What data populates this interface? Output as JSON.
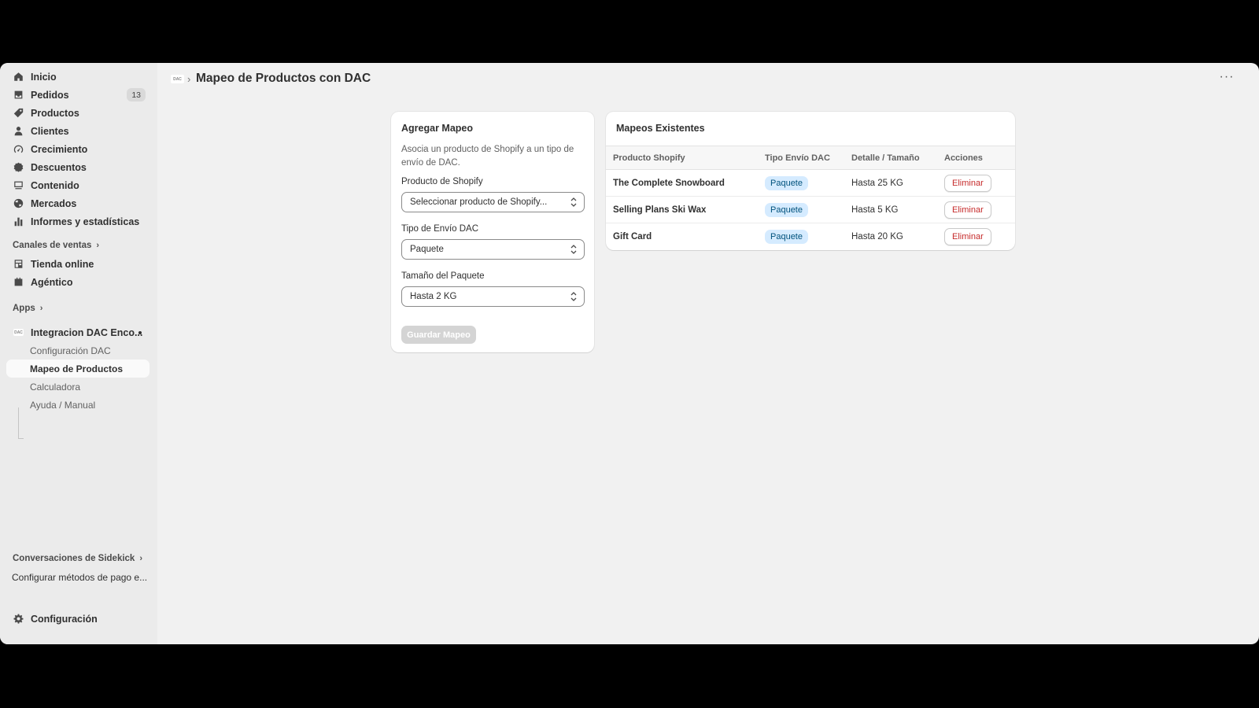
{
  "sidebar": {
    "items": [
      {
        "label": "Inicio",
        "icon": "home-icon"
      },
      {
        "label": "Pedidos",
        "icon": "inbox-icon",
        "badge": "13"
      },
      {
        "label": "Productos",
        "icon": "tag-icon"
      },
      {
        "label": "Clientes",
        "icon": "person-icon"
      },
      {
        "label": "Crecimiento",
        "icon": "gauge-icon"
      },
      {
        "label": "Descuentos",
        "icon": "discount-icon"
      },
      {
        "label": "Contenido",
        "icon": "content-icon"
      },
      {
        "label": "Mercados",
        "icon": "globe-icon"
      },
      {
        "label": "Informes y estadísticas",
        "icon": "chart-bar-icon"
      }
    ],
    "sales_channels_label": "Canales de ventas",
    "channels": [
      {
        "label": "Tienda online",
        "icon": "store-icon"
      },
      {
        "label": "Agéntico",
        "icon": "agentic-icon"
      }
    ],
    "apps_label": "Apps",
    "app_name": "Integracion DAC Enco...",
    "app_logo_text": "DAC",
    "app_subitems": [
      {
        "label": "Configuración DAC"
      },
      {
        "label": "Mapeo de Productos"
      },
      {
        "label": "Calculadora"
      },
      {
        "label": "Ayuda / Manual"
      }
    ],
    "sidekick_label": "Conversaciones de Sidekick",
    "sidekick_item": "Configurar métodos de pago e...",
    "settings_label": "Configuración"
  },
  "header": {
    "logo_text": "DAC",
    "separator": "›",
    "title": "Mapeo de Productos con DAC",
    "more": "···"
  },
  "form": {
    "title": "Agregar Mapeo",
    "description": "Asocia un producto de Shopify a un tipo de envío de DAC.",
    "product_label": "Producto de Shopify",
    "product_value": "Seleccionar producto de Shopify...",
    "type_label": "Tipo de Envío DAC",
    "type_value": "Paquete",
    "size_label": "Tamaño del Paquete",
    "size_value": "Hasta 2 KG",
    "save_label": "Guardar Mapeo"
  },
  "mappings": {
    "title": "Mapeos Existentes",
    "columns": [
      "Producto Shopify",
      "Tipo Envío DAC",
      "Detalle / Tamaño",
      "Acciones"
    ],
    "rows": [
      {
        "product": "The Complete Snowboard",
        "type": "Paquete",
        "detail": "Hasta 25 KG",
        "action": "Eliminar"
      },
      {
        "product": "Selling Plans Ski Wax",
        "type": "Paquete",
        "detail": "Hasta 5 KG",
        "action": "Eliminar"
      },
      {
        "product": "Gift Card",
        "type": "Paquete",
        "detail": "Hasta 20 KG",
        "action": "Eliminar"
      }
    ]
  }
}
